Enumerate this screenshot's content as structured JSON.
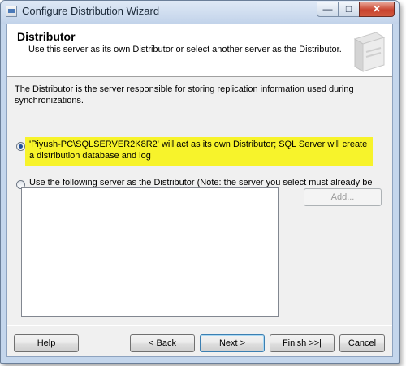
{
  "window": {
    "title": "Configure Distribution Wizard",
    "controls": {
      "minimize": "—",
      "maximize": "□",
      "close": "✕"
    }
  },
  "header": {
    "title": "Distributor",
    "subtitle": "Use this server as its own Distributor or select another server as the Distributor."
  },
  "description": "The Distributor is the server responsible for storing replication information used during synchronizations.",
  "options": [
    {
      "label": "'Piyush-PC\\SQLSERVER2K8R2' will act as its own Distributor; SQL Server will create a distribution database and log",
      "selected": true
    },
    {
      "label": "Use the following server as the Distributor (Note: the server you select must already be configured as a Distributor):",
      "selected": false
    }
  ],
  "server_list": {
    "items": [],
    "add_label": "Add..."
  },
  "buttons": {
    "help": "Help",
    "back": "< Back",
    "next": "Next >",
    "finish": "Finish >>|",
    "cancel": "Cancel"
  },
  "colors": {
    "highlight": "#f7f32b",
    "title_bar": "#c4d6ec",
    "close_button": "#c9432e"
  },
  "icons": {
    "window_icon": "wizard-app-icon",
    "header_graphic": "server-graphic-icon"
  }
}
